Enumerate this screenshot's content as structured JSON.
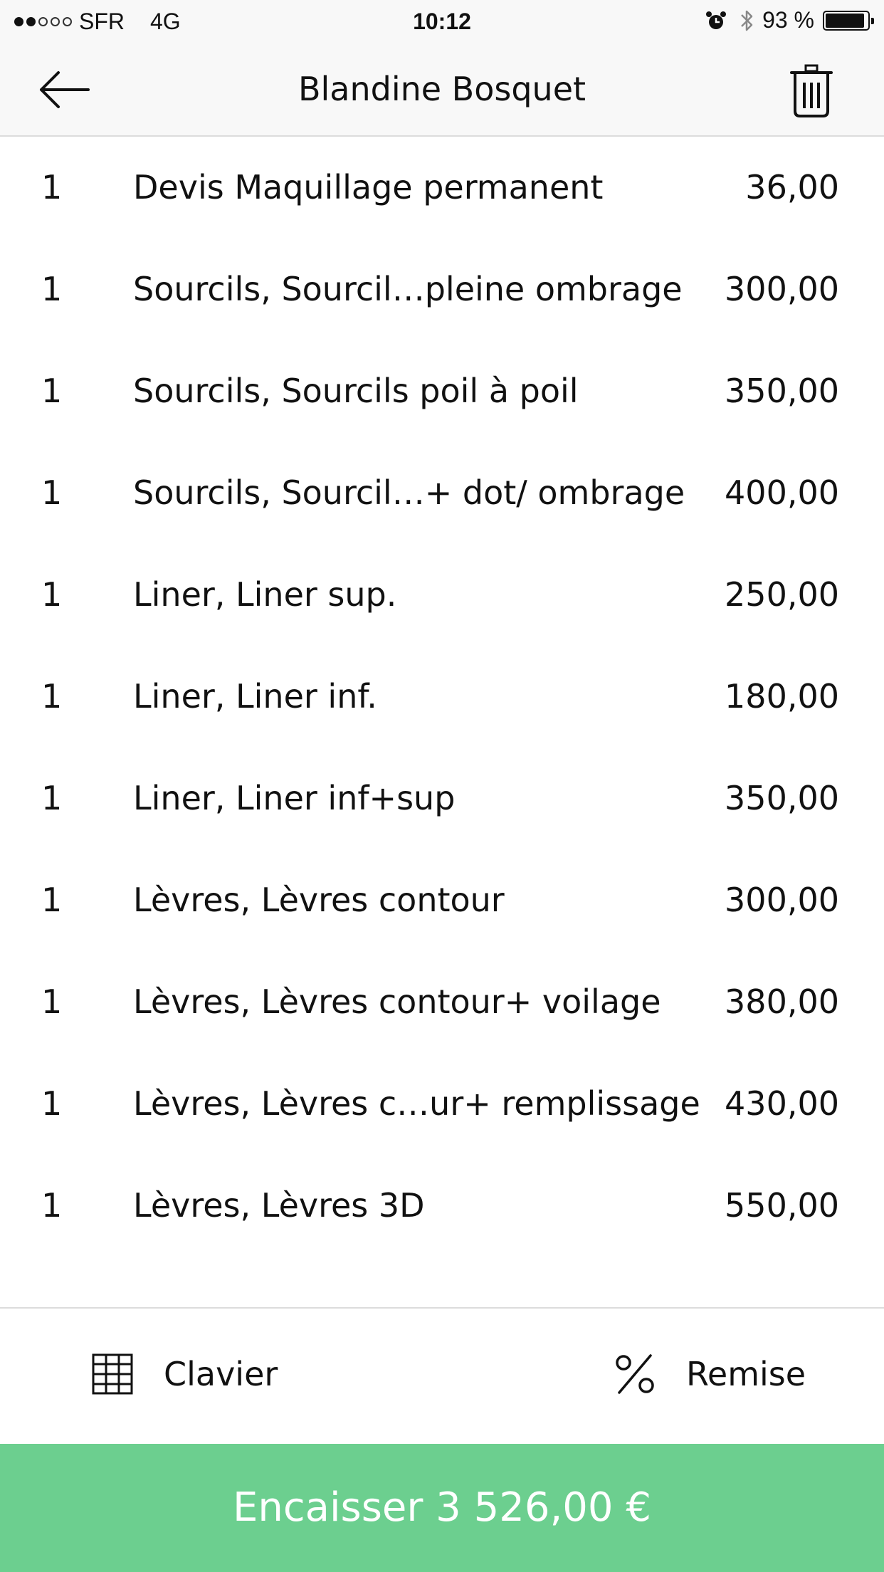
{
  "status_bar": {
    "carrier": "SFR",
    "network": "4G",
    "time": "10:12",
    "battery_percent": "93 %",
    "battery_level": 0.93,
    "signal_bars_filled": 2,
    "signal_bars_total": 5
  },
  "header": {
    "title": "Blandine Bosquet",
    "back_icon": "arrow-left-icon",
    "delete_icon": "trash-icon"
  },
  "items": [
    {
      "qty": "1",
      "name": "Devis Maquillage permanent",
      "price": "36,00"
    },
    {
      "qty": "1",
      "name": "Sourcils, Sourcil…pleine ombrage",
      "price": "300,00"
    },
    {
      "qty": "1",
      "name": "Sourcils, Sourcils poil à poil",
      "price": "350,00"
    },
    {
      "qty": "1",
      "name": "Sourcils, Sourcil…+ dot/ ombrage",
      "price": "400,00"
    },
    {
      "qty": "1",
      "name": "Liner, Liner sup.",
      "price": "250,00"
    },
    {
      "qty": "1",
      "name": "Liner, Liner inf.",
      "price": "180,00"
    },
    {
      "qty": "1",
      "name": "Liner, Liner inf+sup",
      "price": "350,00"
    },
    {
      "qty": "1",
      "name": "Lèvres, Lèvres contour",
      "price": "300,00"
    },
    {
      "qty": "1",
      "name": "Lèvres, Lèvres contour+ voilage",
      "price": "380,00"
    },
    {
      "qty": "1",
      "name": "Lèvres, Lèvres c…ur+ remplissage",
      "price": "430,00"
    },
    {
      "qty": "1",
      "name": "Lèvres, Lèvres 3D",
      "price": "550,00"
    }
  ],
  "actions": {
    "keyboard_label": "Clavier",
    "keyboard_icon": "grid-icon",
    "discount_label": "Remise",
    "discount_icon": "percent-icon"
  },
  "checkout": {
    "label": "Encaisser 3 526,00 €",
    "color": "#6ccf8f"
  },
  "colors": {
    "bar_background": "#f8f8f8",
    "divider": "#dcdcdc",
    "text": "#111111"
  }
}
